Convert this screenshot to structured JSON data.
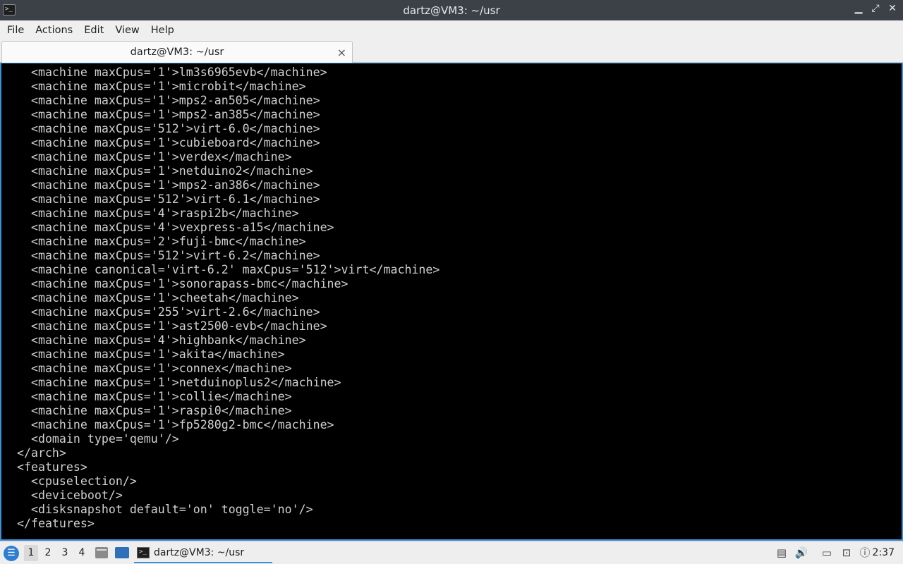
{
  "window": {
    "title": "dartz@VM3: ~/usr",
    "app_icon": ">_",
    "controls": {
      "minimize": "▁",
      "maximize": "⤢",
      "close": "✕"
    }
  },
  "menubar": {
    "items": [
      "File",
      "Actions",
      "Edit",
      "View",
      "Help"
    ]
  },
  "tab": {
    "label": "dartz@VM3: ~/usr",
    "close": "×"
  },
  "terminal": {
    "lines": [
      "    <machine maxCpus='1'>lm3s6965evb</machine>",
      "    <machine maxCpus='1'>microbit</machine>",
      "    <machine maxCpus='1'>mps2-an505</machine>",
      "    <machine maxCpus='1'>mps2-an385</machine>",
      "    <machine maxCpus='512'>virt-6.0</machine>",
      "    <machine maxCpus='1'>cubieboard</machine>",
      "    <machine maxCpus='1'>verdex</machine>",
      "    <machine maxCpus='1'>netduino2</machine>",
      "    <machine maxCpus='1'>mps2-an386</machine>",
      "    <machine maxCpus='512'>virt-6.1</machine>",
      "    <machine maxCpus='4'>raspi2b</machine>",
      "    <machine maxCpus='4'>vexpress-a15</machine>",
      "    <machine maxCpus='2'>fuji-bmc</machine>",
      "    <machine maxCpus='512'>virt-6.2</machine>",
      "    <machine canonical='virt-6.2' maxCpus='512'>virt</machine>",
      "    <machine maxCpus='1'>sonorapass-bmc</machine>",
      "    <machine maxCpus='1'>cheetah</machine>",
      "    <machine maxCpus='255'>virt-2.6</machine>",
      "    <machine maxCpus='1'>ast2500-evb</machine>",
      "    <machine maxCpus='4'>highbank</machine>",
      "    <machine maxCpus='1'>akita</machine>",
      "    <machine maxCpus='1'>connex</machine>",
      "    <machine maxCpus='1'>netduinoplus2</machine>",
      "    <machine maxCpus='1'>collie</machine>",
      "    <machine maxCpus='1'>raspi0</machine>",
      "    <machine maxCpus='1'>fp5280g2-bmc</machine>",
      "    <domain type='qemu'/>",
      "  </arch>",
      "  <features>",
      "    <cpuselection/>",
      "    <deviceboot/>",
      "    <disksnapshot default='on' toggle='no'/>",
      "  </features>"
    ]
  },
  "taskbar": {
    "workspaces": [
      "1",
      "2",
      "3",
      "4"
    ],
    "active_workspace": "1",
    "task_label": "dartz@VM3: ~/usr",
    "clock": "2:37",
    "icons": [
      "start-menu-icon",
      "file-manager-icon",
      "show-desktop-icon",
      "terminal-icon",
      "clipboard-icon",
      "volume-icon",
      "notes-icon",
      "network-icon",
      "notification-icon"
    ]
  },
  "colors": {
    "terminal_bg": "#000000",
    "terminal_fg": "#d0d0d0",
    "accent": "#3d8fd6",
    "titlebar_bg": "#3c4148"
  }
}
